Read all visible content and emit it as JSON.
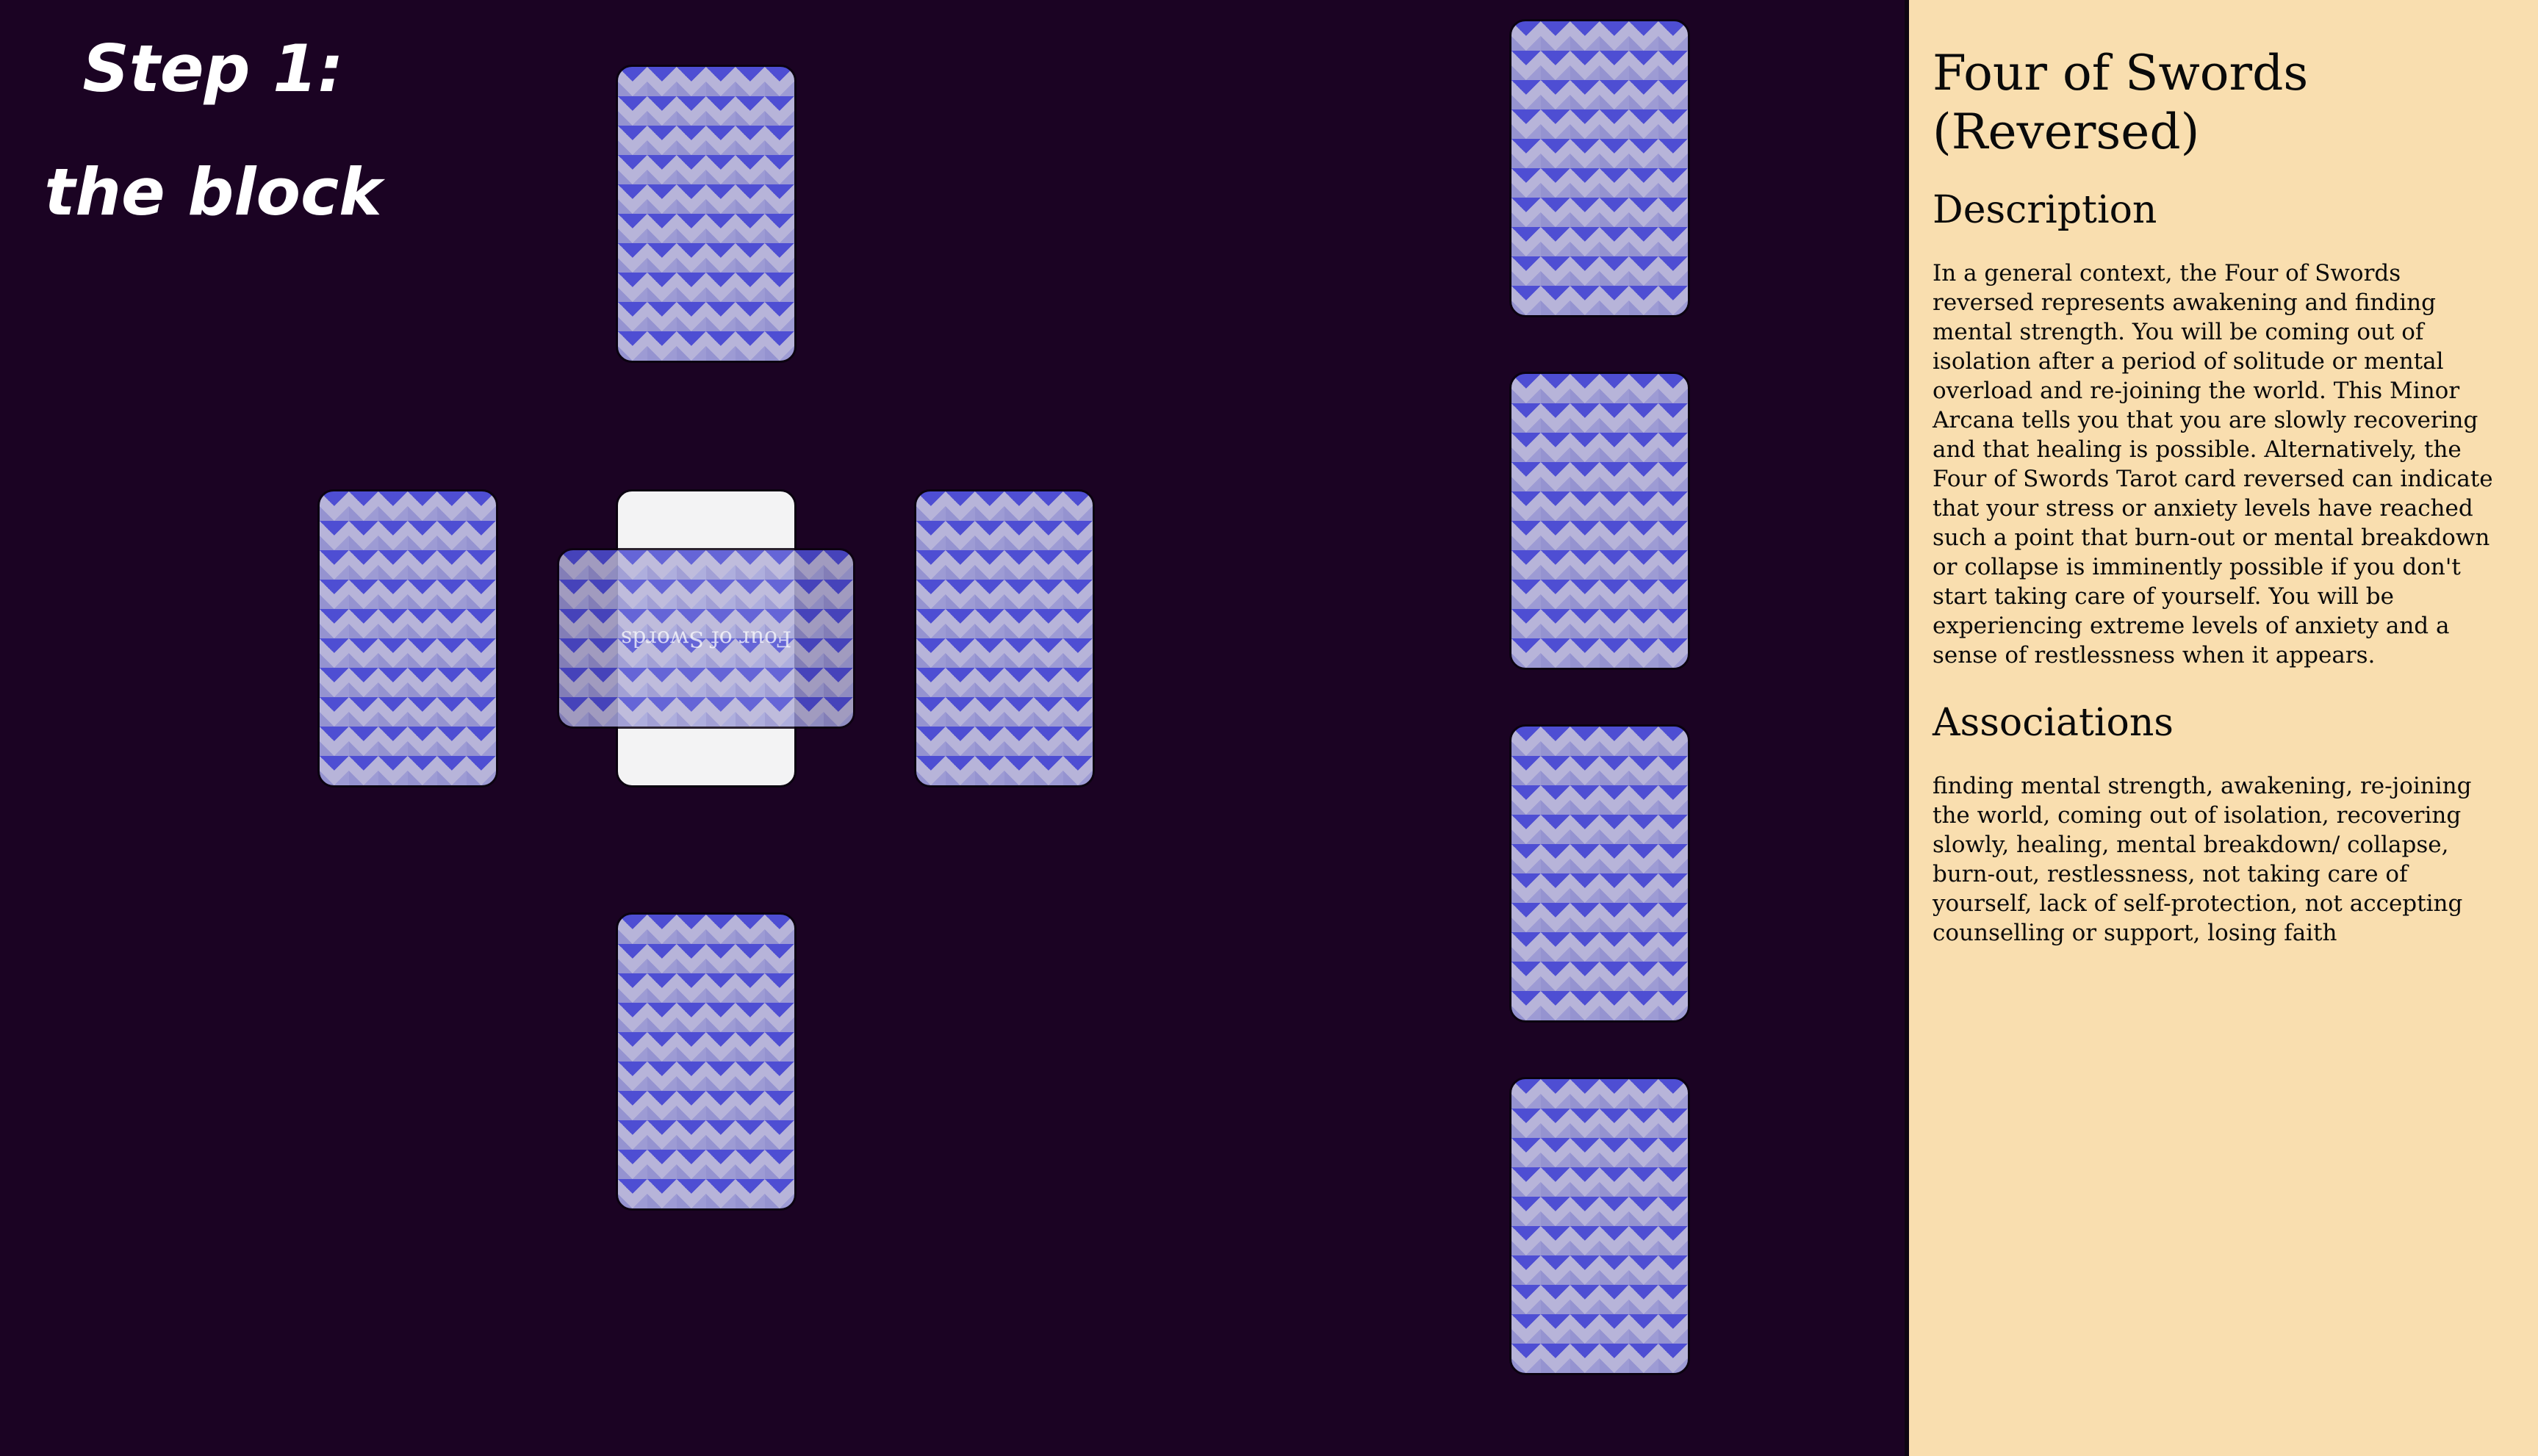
{
  "stage": {
    "step_title": "Step 1: the block",
    "crossing_card_label": "Four of Swords"
  },
  "panel": {
    "card_title": "Four of Swords (Reversed)",
    "description_heading": "Description",
    "description_text": "In a general context, the Four of Swords reversed represents awakening and finding mental strength. You will be coming out of isolation after a period of solitude or mental overload and re-joining the world. This Minor Arcana tells you that you are slowly recovering and that healing is possible. Alternatively, the Four of Swords Tarot card reversed can indicate that your stress or anxiety levels have reached such a point that burn-out or mental breakdown or collapse is imminently possible if you don't start taking care of yourself. You will be experiencing extreme levels of anxiety and a sense of restlessness when it appears.",
    "associations_heading": "Associations",
    "associations_text": "finding mental strength, awakening, re-joining the world, coming out of isolation, recovering slowly, healing, mental breakdown/ collapse, burn-out, restlessness, not taking care of yourself, lack of self-protection, not accepting counselling or support, losing faith"
  },
  "colors": {
    "stage_background": "#1b0323",
    "panel_background": "#f9deaf",
    "card_pattern_blue": "#3c3cd2",
    "card_face": "#f3f3f4"
  }
}
